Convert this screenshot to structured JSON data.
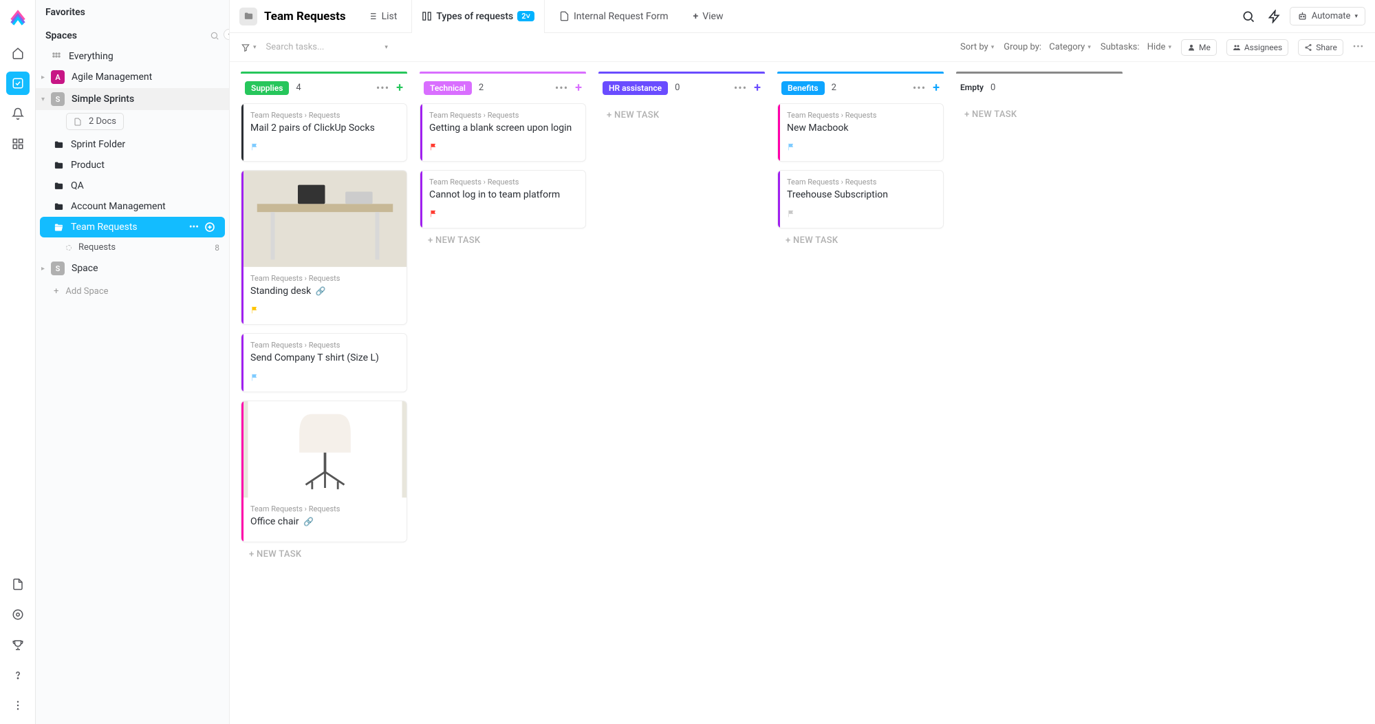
{
  "sidebar": {
    "favorites_label": "Favorites",
    "spaces_label": "Spaces",
    "everything_label": "Everything",
    "spaces": [
      {
        "letter": "A",
        "name": "Agile Management",
        "color": "pink"
      },
      {
        "letter": "S",
        "name": "Simple Sprints",
        "color": "gray",
        "expanded": true,
        "docs": "2 Docs",
        "folders": [
          {
            "name": "Sprint Folder"
          },
          {
            "name": "Product"
          },
          {
            "name": "QA"
          },
          {
            "name": "Account Management"
          },
          {
            "name": "Team Requests",
            "active": true,
            "lists": [
              {
                "name": "Requests",
                "count": 8
              }
            ]
          }
        ]
      },
      {
        "letter": "S",
        "name": "Space",
        "color": "gray"
      }
    ],
    "add_space": "Add Space"
  },
  "header": {
    "title": "Team Requests",
    "tabs": [
      {
        "label": "List",
        "icon": "list"
      },
      {
        "label": "Types of requests",
        "icon": "board",
        "badge": "2",
        "active": true
      },
      {
        "label": "Internal Request Form",
        "icon": "doc"
      },
      {
        "label": "View",
        "icon": "plus"
      }
    ],
    "automate": "Automate"
  },
  "filters": {
    "search_placeholder": "Search tasks...",
    "sort": "Sort by",
    "group": "Group by:",
    "group_value": "Category",
    "subtasks": "Subtasks:",
    "subtasks_value": "Hide",
    "me": "Me",
    "assignees": "Assignees",
    "share": "Share"
  },
  "board": {
    "crumb_parent": "Team Requests",
    "crumb_child": "Requests",
    "new_task": "+ NEW TASK",
    "columns": [
      {
        "name": "Supplies",
        "count": 4,
        "color": "#26c65b",
        "bar": "#26c65b",
        "plus": "#26c65b",
        "cards": [
          {
            "bar": "#2a2e34",
            "title": "Mail 2 pairs of ClickUp Socks",
            "flag": "#7ecbff"
          },
          {
            "bar": "#a020f0",
            "title": "Standing desk",
            "flag": "#ffc400",
            "image": "desk",
            "attach": true
          },
          {
            "bar": "#a020f0",
            "title": "Send Company T shirt (Size L)",
            "flag": "#7ecbff"
          },
          {
            "bar": "#ff00aa",
            "title": "Office chair",
            "image": "chair",
            "attach": true
          }
        ]
      },
      {
        "name": "Technical",
        "count": 2,
        "color": "#d96eff",
        "bar": "#d96eff",
        "plus": "#d96eff",
        "cards": [
          {
            "bar": "#a020f0",
            "title": "Getting a blank screen upon login",
            "flag": "#ff3b30"
          },
          {
            "bar": "#a020f0",
            "title": "Cannot log in to team platform",
            "flag": "#ff3b30"
          }
        ]
      },
      {
        "name": "HR assistance",
        "count": 0,
        "color": "#6a4cff",
        "bar": "#6a4cff",
        "plus": "#6a4cff",
        "cards": []
      },
      {
        "name": "Benefits",
        "count": 2,
        "color": "#0ea5ff",
        "bar": "#0ea5ff",
        "plus": "#0ea5ff",
        "cards": [
          {
            "bar": "#ff00aa",
            "title": "New Macbook",
            "flag": "#7ecbff"
          },
          {
            "bar": "#a020f0",
            "title": "Treehouse Subscription",
            "flag": "#c8c8c8"
          }
        ]
      },
      {
        "name": "Empty",
        "count": 0,
        "color": "none",
        "bar": "#888",
        "cards": []
      }
    ]
  }
}
